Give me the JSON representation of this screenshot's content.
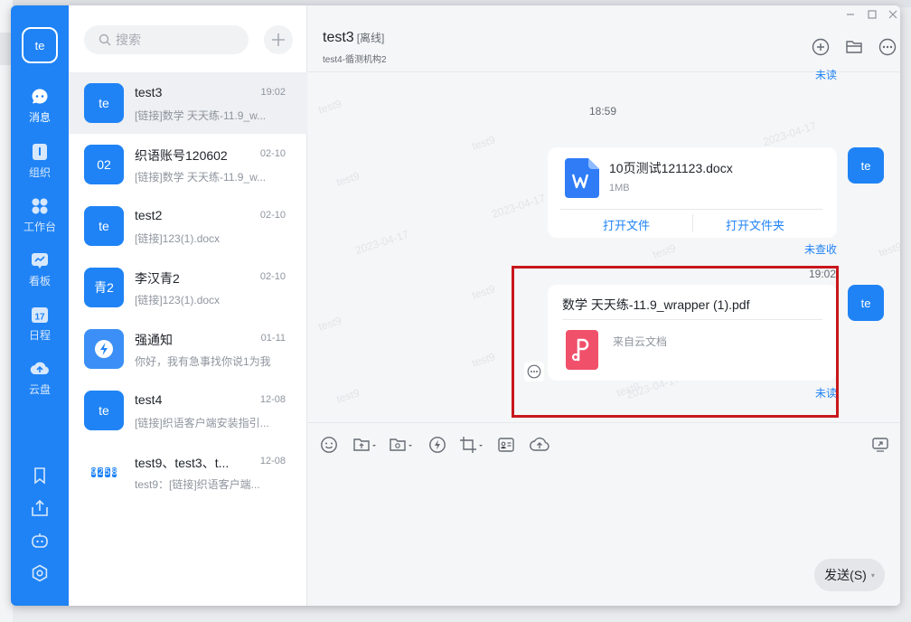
{
  "nav": {
    "avatar": "te",
    "items": [
      {
        "label": "消息",
        "icon": "chat-bubble-icon"
      },
      {
        "label": "组织",
        "icon": "organization-icon"
      },
      {
        "label": "工作台",
        "icon": "workbench-grid-icon"
      },
      {
        "label": "看板",
        "icon": "board-icon"
      },
      {
        "label": "日程",
        "icon": "calendar-icon"
      },
      {
        "label": "云盘",
        "icon": "cloud-drive-icon"
      }
    ],
    "bottom_icons": [
      "bookmark-icon",
      "share-upload-icon",
      "bot-icon",
      "settings-icon"
    ]
  },
  "list": {
    "search_placeholder": "搜索",
    "conversations": [
      {
        "avatar": "te",
        "name": "test3",
        "time": "19:02",
        "preview": "[链接]数学 天天练-11.9_w..."
      },
      {
        "avatar": "02",
        "name": "织语账号120602",
        "time": "02-10",
        "preview": "[链接]数学 天天练-11.9_w..."
      },
      {
        "avatar": "te",
        "name": "test2",
        "time": "02-10",
        "preview": "[链接]123(1).docx"
      },
      {
        "avatar": "青2",
        "name": "李汉青2",
        "time": "02-10",
        "preview": "[链接]123(1).docx"
      },
      {
        "avatar": "",
        "name": "强通知",
        "time": "01-11",
        "preview": "你好，我有急事找你说1为我"
      },
      {
        "avatar": "te",
        "name": "test4",
        "time": "12-08",
        "preview": "[链接]织语客户端安装指引..."
      },
      {
        "avatar_grid": [
          "9",
          "2",
          "5",
          "8"
        ],
        "name": "test9、test3、t...",
        "time": "12-08",
        "preview": "test9：[链接]织语客户端..."
      }
    ]
  },
  "chat": {
    "title": "test3",
    "status": "[离线]",
    "subtitle": "test4-循测机构2",
    "top_unread": "未读",
    "time1": "18:59",
    "file_message": {
      "name": "10页测试121123.docx",
      "size": "1MB",
      "open_file": "打开文件",
      "open_folder": "打开文件夹",
      "read_status": "未查收"
    },
    "time2": "19:02",
    "link_message": {
      "title": "数学 天天练-11.9_wrapper (1).pdf",
      "source": "来自云文档",
      "read_status": "未读"
    },
    "my_avatar": "te",
    "watermarks": [
      "test9",
      "test9",
      "test9",
      "2023-04-17",
      "test9",
      "2023-04-17",
      "2023-04-17",
      "test9",
      "test9",
      "test9",
      "test9",
      "test9",
      "2023-04-17",
      "test9"
    ],
    "send_label": "发送(S)",
    "send_caret": "▾"
  },
  "colors": {
    "accent": "#1f83f5",
    "highlight_border": "#c8171c"
  }
}
